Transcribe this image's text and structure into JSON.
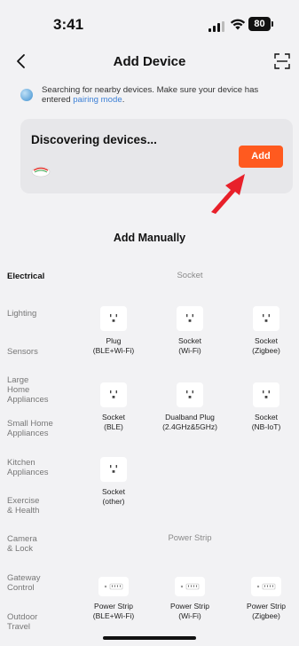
{
  "status_bar": {
    "time": "3:41",
    "battery": "80"
  },
  "nav": {
    "title": "Add Device",
    "back_icon": "chevron-left-icon",
    "scan_icon": "scan-icon"
  },
  "notice": {
    "text": "Searching for nearby devices. Make sure your device has entered ",
    "link": "pairing mode",
    "tail": "."
  },
  "discover": {
    "title": "Discovering devices...",
    "add_label": "Add"
  },
  "manual": {
    "title": "Add Manually"
  },
  "categories": [
    {
      "label": "Electrical"
    },
    {
      "label": "Lighting"
    },
    {
      "label": "Sensors"
    },
    {
      "label": "Large\nHome\nAppliances"
    },
    {
      "label": "Small Home\nAppliances"
    },
    {
      "label": "Kitchen\nAppliances"
    },
    {
      "label": "Exercise\n& Health"
    },
    {
      "label": "Camera\n& Lock"
    },
    {
      "label": "Gateway\nControl"
    },
    {
      "label": "Outdoor\nTravel"
    }
  ],
  "sections": [
    {
      "title": "Socket",
      "items": [
        {
          "label": "Plug\n(BLE+Wi-Fi)"
        },
        {
          "label": "Socket\n(Wi-Fi)"
        },
        {
          "label": "Socket\n(Zigbee)"
        },
        {
          "label": "Socket\n(BLE)"
        },
        {
          "label": "Dualband Plug\n(2.4GHz&5GHz)"
        },
        {
          "label": "Socket\n(NB-IoT)"
        },
        {
          "label": "Socket\n(other)"
        }
      ]
    },
    {
      "title": "Power Strip",
      "items": [
        {
          "label": "Power Strip\n(BLE+Wi-Fi)"
        },
        {
          "label": "Power Strip\n(Wi-Fi)"
        },
        {
          "label": "Power Strip\n(Zigbee)"
        }
      ]
    }
  ],
  "colors": {
    "accent": "#ff5a1f",
    "link": "#3b7fd6",
    "arrow": "#e8202a"
  }
}
